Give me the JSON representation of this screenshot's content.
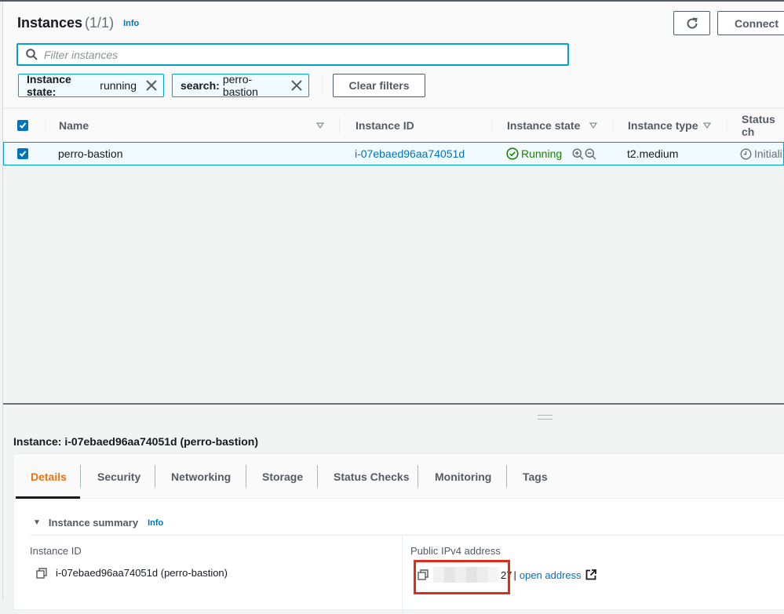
{
  "header": {
    "title": "Instances",
    "count": "(1/1)",
    "info_label": "Info",
    "connect_label": "Connect",
    "refresh_icon": "refresh-icon"
  },
  "search": {
    "placeholder": "Filter instances",
    "value": ""
  },
  "filters": [
    {
      "key": "Instance state:",
      "value": "running"
    },
    {
      "key": "search:",
      "value": "perro-bastion"
    }
  ],
  "clear_filters_label": "Clear filters",
  "table": {
    "columns": [
      "Name",
      "Instance ID",
      "Instance state",
      "Instance type",
      "Status ch"
    ],
    "select_all_checked": true,
    "rows": [
      {
        "selected": true,
        "name": "perro-bastion",
        "instance_id": "i-07ebaed96aa74051d",
        "state": "Running",
        "type": "t2.medium",
        "status_check": "Initiali"
      }
    ]
  },
  "details": {
    "title": "Instance: i-07ebaed96aa74051d (perro-bastion)",
    "tabs": [
      "Details",
      "Security",
      "Networking",
      "Storage",
      "Status Checks",
      "Monitoring",
      "Tags"
    ],
    "active_tab": "Details",
    "summary_title": "Instance summary",
    "summary_info": "Info",
    "instance_id_label": "Instance ID",
    "instance_id_value": "i-07ebaed96aa74051d (perro-bastion)",
    "public_ip_label": "Public IPv4 address",
    "public_ip_suffix": "27",
    "open_address_label": "open address"
  },
  "colors": {
    "accent": "#0073bb",
    "running": "#1d8102",
    "active_tab": "#ec7211",
    "filter_border": "#00a1c9",
    "highlight_box": "#e02c1b"
  }
}
